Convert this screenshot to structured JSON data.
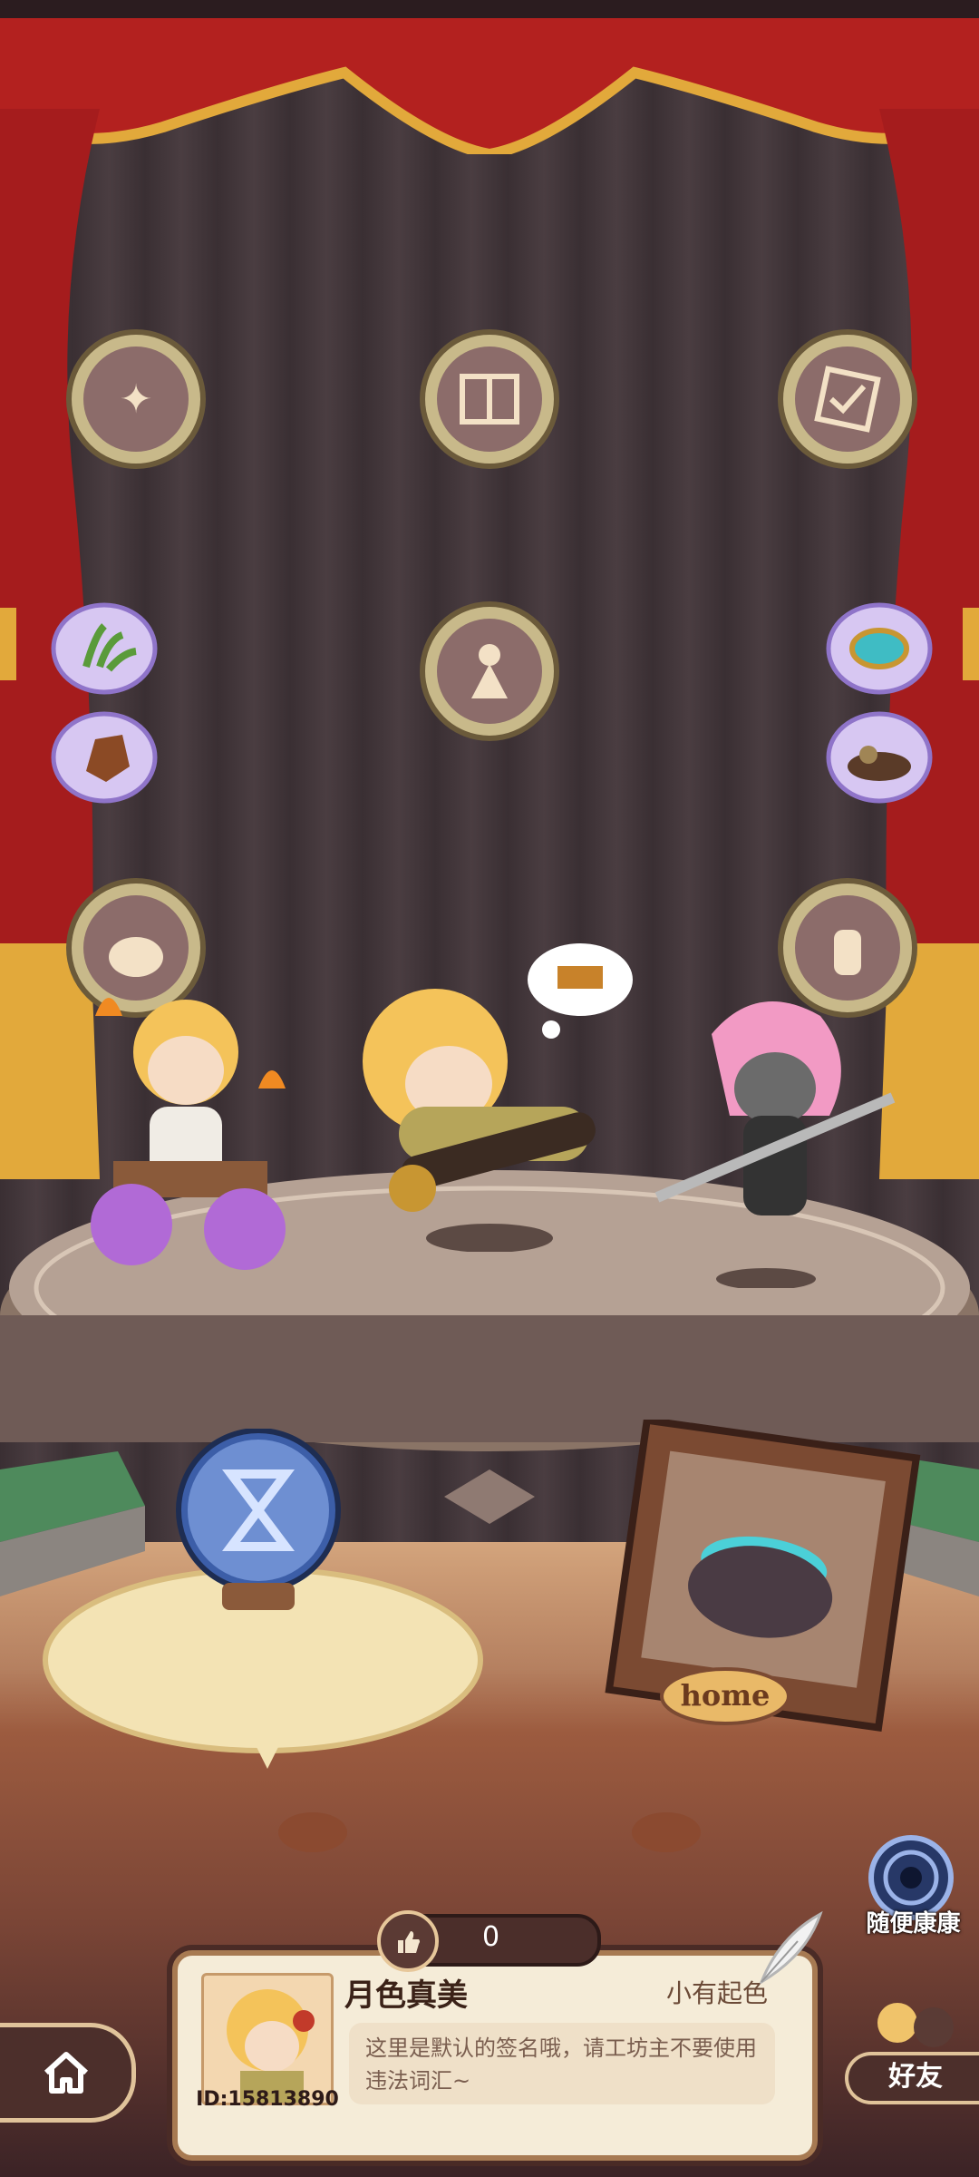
{
  "profile": {
    "name": "月色真美",
    "title": "小有起色",
    "id_label": "ID:15813890",
    "signature": "这里是默认的签名哦，请工坊主不要使用违法词汇~",
    "likes": "0"
  },
  "buttons": {
    "friends_label": "好友",
    "visit_random_label": "随便康康",
    "home_frame_label": "home"
  },
  "icons": {
    "home": "home-icon",
    "like": "thumbs-up-icon",
    "hourglass": "hourglass-icon",
    "portal": "portal-icon",
    "quill": "quill-icon"
  },
  "colors": {
    "curtain": "#b3211f",
    "gold": "#e2a93b",
    "panel_bg": "#f5ecd8",
    "dark_brown": "#4c2f2b"
  }
}
